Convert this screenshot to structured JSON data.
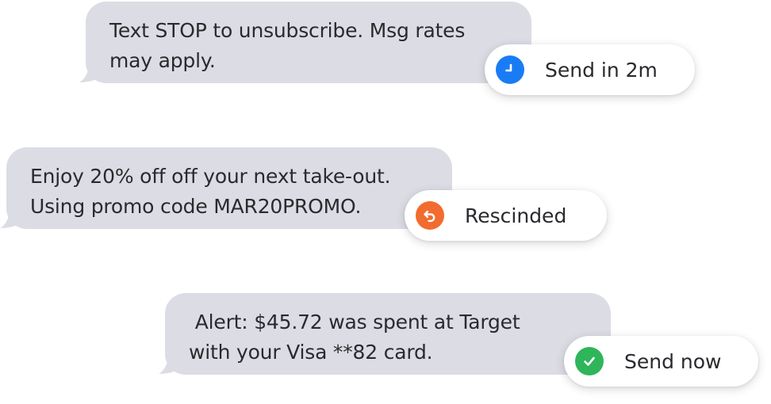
{
  "messages": [
    {
      "lines": [
        "Text STOP to unsubscribe. Msg rates",
        "may apply."
      ],
      "status": {
        "label": "Send in 2m",
        "icon": "clock-icon",
        "color": "#1a7cf5"
      }
    },
    {
      "lines": [
        "Enjoy 20% off off your next take-out.",
        "Using promo code MAR20PROMO."
      ],
      "status": {
        "label": "Rescinded",
        "icon": "undo-icon",
        "color": "#f26b2f"
      }
    },
    {
      "lines": [
        " Alert: $45.72 was spent at Target",
        "with your Visa **82 card."
      ],
      "status": {
        "label": "Send now",
        "icon": "check-icon",
        "color": "#2fb55a"
      }
    }
  ],
  "colors": {
    "bubble": "#dcdce4",
    "text": "#2a2a2e"
  }
}
